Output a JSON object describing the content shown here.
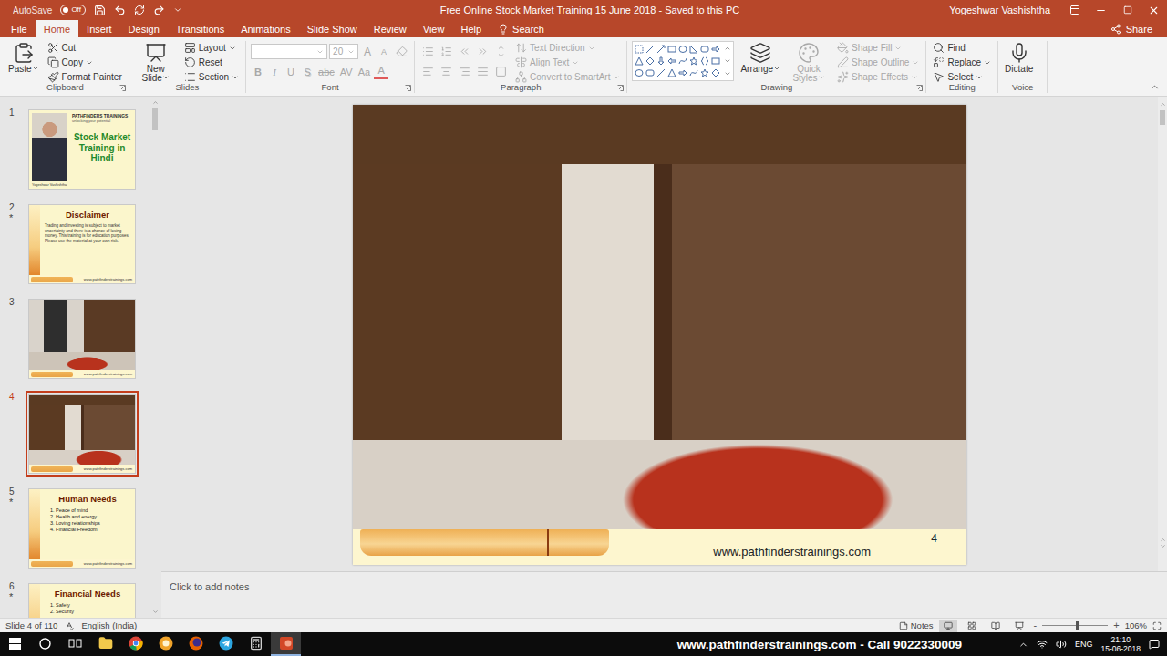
{
  "window": {
    "title": "Free Online Stock Market Training 15 June 2018  -  Saved to this PC",
    "user": "Yogeshwar Vashishtha",
    "autosave": {
      "label": "AutoSave",
      "state": "Off",
      "on": false
    }
  },
  "tabs": [
    {
      "label": "File",
      "selected": false
    },
    {
      "label": "Home",
      "selected": true
    },
    {
      "label": "Insert",
      "selected": false
    },
    {
      "label": "Design",
      "selected": false
    },
    {
      "label": "Transitions",
      "selected": false
    },
    {
      "label": "Animations",
      "selected": false
    },
    {
      "label": "Slide Show",
      "selected": false
    },
    {
      "label": "Review",
      "selected": false
    },
    {
      "label": "View",
      "selected": false
    },
    {
      "label": "Help",
      "selected": false
    }
  ],
  "search": {
    "label": "Search"
  },
  "share": {
    "label": "Share"
  },
  "ribbon": [
    {
      "label": "Clipboard",
      "launcher": true,
      "columns": [
        [
          [
            {
              "kind": "large",
              "label": "Paste",
              "disabled": false,
              "has_menu": true
            }
          ]
        ],
        [
          [
            {
              "kind": "small",
              "label": "Cut",
              "disabled": false,
              "has_menu": false
            }
          ],
          [
            {
              "kind": "small",
              "label": "Copy",
              "disabled": false,
              "has_menu": true
            }
          ],
          [
            {
              "kind": "small",
              "label": "Format Painter",
              "disabled": false,
              "has_menu": false
            }
          ]
        ]
      ]
    },
    {
      "label": "Slides",
      "launcher": false,
      "columns": [
        [
          [
            {
              "kind": "large",
              "label": "New Slide",
              "disabled": false,
              "has_menu": true
            }
          ]
        ],
        [
          [
            {
              "kind": "small",
              "label": "Layout",
              "disabled": false,
              "has_menu": true
            }
          ],
          [
            {
              "kind": "small",
              "label": "Reset",
              "disabled": false,
              "has_menu": false
            }
          ],
          [
            {
              "kind": "small",
              "label": "Section",
              "disabled": false,
              "has_menu": true
            }
          ]
        ]
      ]
    },
    {
      "label": "Font",
      "launcher": true,
      "columns": [
        [
          [
            {
              "kind": "font-field",
              "value": "",
              "disabled": true
            },
            {
              "kind": "size-field",
              "value": "20",
              "disabled": true
            },
            {
              "kind": "glyph",
              "label": "A",
              "disabled": true
            },
            {
              "kind": "glyph",
              "label": "A",
              "disabled": true
            },
            {
              "kind": "iconbutton",
              "disabled": true
            }
          ],
          [
            {
              "kind": "glyph",
              "label": "B",
              "disabled": true
            },
            {
              "kind": "glyph",
              "label": "I",
              "disabled": true
            },
            {
              "kind": "glyph",
              "label": "U",
              "disabled": true
            },
            {
              "kind": "glyph",
              "label": "S",
              "disabled": true
            },
            {
              "kind": "glyph",
              "label": "abc",
              "disabled": true
            },
            {
              "kind": "glyph",
              "label": "AV",
              "disabled": true
            },
            {
              "kind": "glyph",
              "label": "Aa",
              "disabled": true
            },
            {
              "kind": "glyph",
              "label": "A",
              "disabled": true
            }
          ]
        ]
      ]
    },
    {
      "label": "Paragraph",
      "launcher": true,
      "columns": [
        [
          [
            {
              "kind": "iconbutton",
              "disabled": true
            },
            {
              "kind": "iconbutton",
              "disabled": true
            },
            {
              "kind": "iconbutton",
              "disabled": true
            },
            {
              "kind": "iconbutton",
              "disabled": true
            },
            {
              "kind": "iconbutton",
              "disabled": true
            }
          ],
          [
            {
              "kind": "iconbutton",
              "disabled": true
            },
            {
              "kind": "iconbutton",
              "disabled": true
            },
            {
              "kind": "iconbutton",
              "disabled": true
            },
            {
              "kind": "iconbutton",
              "disabled": true
            },
            {
              "kind": "iconbutton",
              "disabled": true
            }
          ]
        ],
        [
          [
            {
              "kind": "small",
              "label": "Text Direction",
              "disabled": true,
              "has_menu": true
            }
          ],
          [
            {
              "kind": "small",
              "label": "Align Text",
              "disabled": true,
              "has_menu": true
            }
          ],
          [
            {
              "kind": "small",
              "label": "Convert to SmartArt",
              "disabled": true,
              "has_menu": true
            }
          ]
        ]
      ]
    },
    {
      "label": "Drawing",
      "launcher": true,
      "columns": [
        [
          [
            {
              "kind": "shapes",
              "disabled": false
            }
          ]
        ],
        [
          [
            {
              "kind": "large",
              "label": "Arrange",
              "disabled": false,
              "has_menu": true
            }
          ]
        ],
        [
          [
            {
              "kind": "large",
              "label": "Quick Styles",
              "disabled": true,
              "has_menu": true
            }
          ]
        ],
        [
          [
            {
              "kind": "small",
              "label": "Shape Fill",
              "disabled": true,
              "has_menu": true
            }
          ],
          [
            {
              "kind": "small",
              "label": "Shape Outline",
              "disabled": true,
              "has_menu": true
            }
          ],
          [
            {
              "kind": "small",
              "label": "Shape Effects",
              "disabled": true,
              "has_menu": true
            }
          ]
        ]
      ]
    },
    {
      "label": "Editing",
      "launcher": false,
      "columns": [
        [
          [
            {
              "kind": "small",
              "label": "Find",
              "disabled": false,
              "has_menu": false
            }
          ],
          [
            {
              "kind": "small",
              "label": "Replace",
              "disabled": false,
              "has_menu": true
            }
          ],
          [
            {
              "kind": "small",
              "label": "Select",
              "disabled": false,
              "has_menu": true
            }
          ]
        ]
      ]
    },
    {
      "label": "Voice",
      "launcher": false,
      "columns": [
        [
          [
            {
              "kind": "large",
              "label": "Dictate",
              "disabled": false,
              "has_menu": false
            }
          ]
        ]
      ]
    }
  ],
  "slides_pane": {
    "animation_mark": "*"
  },
  "thumbnails": [
    {
      "number": "1",
      "kind": "title",
      "selected": false,
      "animated": false,
      "brand": "PATHFINDERS TRAININGS",
      "tagline": "unlocking your potential",
      "title": "Stock Market Training in Hindi",
      "name": "Yogeshwar Vashishtha"
    },
    {
      "number": "2",
      "kind": "text",
      "selected": false,
      "animated": true,
      "title": "Disclaimer",
      "body": "Trading and investing is subject to market uncertainty and there is a chance of losing money. This training is for education purposes. Please use the material at your own risk.",
      "footer": "www.pathfinderstrainings.com"
    },
    {
      "number": "3",
      "kind": "photo",
      "selected": false,
      "animated": false,
      "footer": "www.pathfinderstrainings.com"
    },
    {
      "number": "4",
      "kind": "photo",
      "selected": true,
      "animated": false,
      "footer": "www.pathfinderstrainings.com"
    },
    {
      "number": "5",
      "kind": "list",
      "selected": false,
      "animated": true,
      "title": "Human Needs",
      "items": [
        "1.  Peace of mind",
        "2.  Health and energy",
        "3.  Loving relationships",
        "4.  Financial Freedom"
      ],
      "footer": "www.pathfinderstrainings.com"
    },
    {
      "number": "6",
      "kind": "list",
      "selected": false,
      "animated": true,
      "title": "Financial Needs",
      "items": [
        "1.  Safety",
        "2.  Security"
      ],
      "footer": "www.pathfinderstrainings.com"
    }
  ],
  "slide": {
    "number": "4",
    "footer": "www.pathfinderstrainings.com"
  },
  "notes": {
    "placeholder": "Click to add notes"
  },
  "status_bar": {
    "slide_info": "Slide 4 of 110",
    "language": "English (India)",
    "notes_label": "Notes",
    "views": [
      {
        "selected": true
      },
      {
        "selected": false
      },
      {
        "selected": false
      },
      {
        "selected": false
      }
    ],
    "zoom_out": "-",
    "zoom_in": "+",
    "zoom": "106%",
    "zoom_level": 0.53
  },
  "taskbar": {
    "apps": [
      {
        "active": false
      },
      {
        "active": false
      },
      {
        "active": false
      },
      {
        "active": false
      },
      {
        "active": false
      },
      {
        "active": false
      },
      {
        "active": true
      }
    ],
    "overlay_text": "www.pathfinderstrainings.com - Call 9022330009",
    "language": "ENG",
    "time": "21:10",
    "date": "15-06-2018"
  }
}
